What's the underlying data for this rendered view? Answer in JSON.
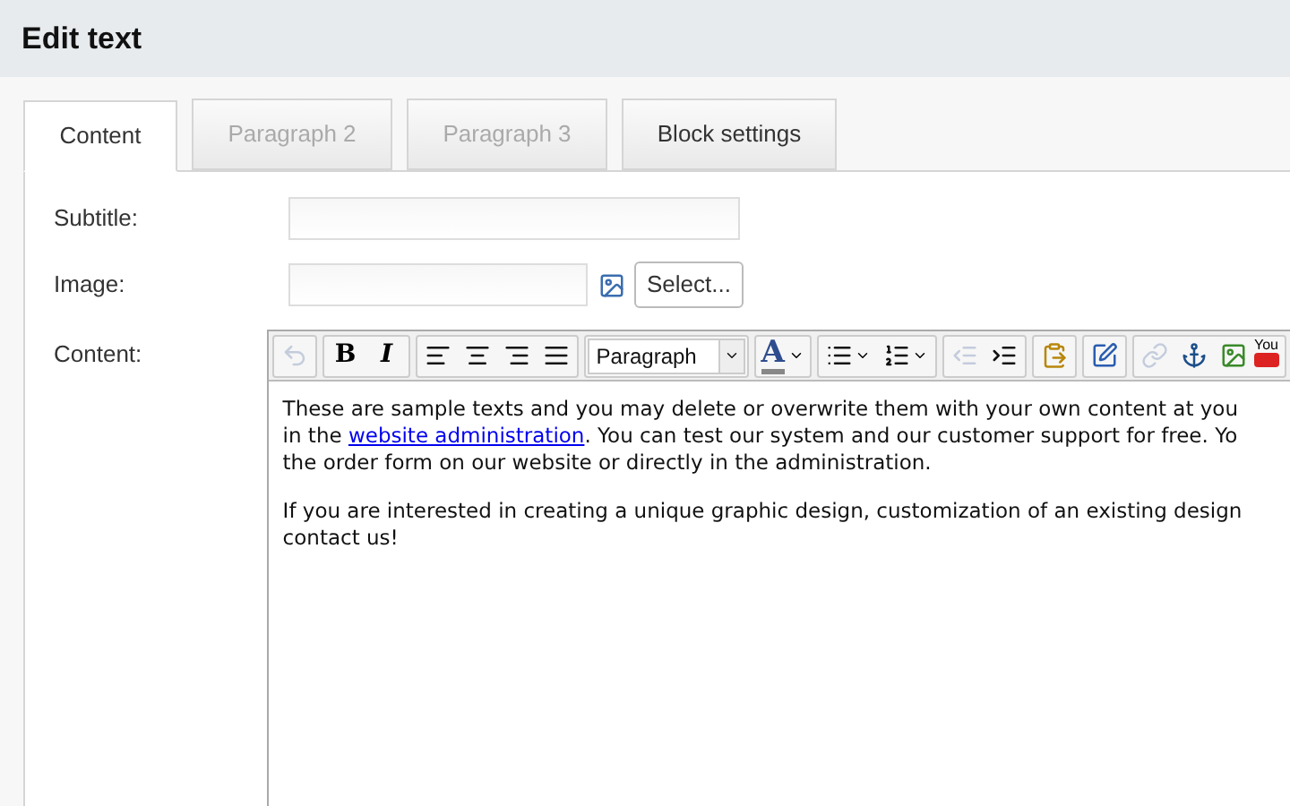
{
  "header": {
    "title": "Edit text"
  },
  "tabs": [
    {
      "label": "Content",
      "selected": true,
      "disabled": false
    },
    {
      "label": "Paragraph 2",
      "selected": false,
      "disabled": true
    },
    {
      "label": "Paragraph 3",
      "selected": false,
      "disabled": true
    },
    {
      "label": "Block settings",
      "selected": false,
      "disabled": false
    }
  ],
  "form": {
    "subtitle": {
      "label": "Subtitle:"
    },
    "image": {
      "label": "Image:",
      "button": "Select..."
    },
    "content": {
      "label": "Content:"
    }
  },
  "toolbar": [
    [
      {
        "kind": "undo",
        "disabled": true
      }
    ],
    [
      {
        "kind": "bold",
        "text": "B",
        "disabled": false
      },
      {
        "kind": "italic",
        "text": "I",
        "disabled": false
      }
    ],
    [
      {
        "kind": "alignleft",
        "disabled": false
      },
      {
        "kind": "aligncenter",
        "disabled": false
      },
      {
        "kind": "alignright",
        "disabled": false
      },
      {
        "kind": "justify",
        "disabled": false
      }
    ],
    [
      {
        "kind": "format",
        "text": "Paragraph",
        "disabled": false
      }
    ],
    [
      {
        "kind": "textcolor",
        "text": "A",
        "disabled": false
      }
    ],
    [
      {
        "kind": "bullets",
        "disabled": false
      },
      {
        "kind": "numbers",
        "disabled": false
      }
    ],
    [
      {
        "kind": "outdent",
        "disabled": true
      },
      {
        "kind": "indent",
        "disabled": false
      }
    ],
    [
      {
        "kind": "pasteword",
        "disabled": false
      }
    ],
    [
      {
        "kind": "source",
        "disabled": false
      }
    ],
    [
      {
        "kind": "link",
        "disabled": true
      },
      {
        "kind": "anchor",
        "disabled": false
      },
      {
        "kind": "image",
        "disabled": false
      },
      {
        "kind": "video",
        "text": "You",
        "disabled": false
      }
    ]
  ],
  "editor": {
    "paragraphs": [
      {
        "lines": [
          {
            "text": "These are sample texts and you may delete or overwrite them with your own content at you"
          },
          {
            "before": "in the ",
            "link": "website administration",
            "after": ". You can test our system and our customer support for free. Yo"
          },
          {
            "text": "the order form on our website or directly in the administration."
          }
        ]
      },
      {
        "lines": [
          {
            "text": "If you are interested in creating a unique graphic design, customization of an existing design"
          },
          {
            "text": "contact us!"
          }
        ]
      }
    ]
  }
}
